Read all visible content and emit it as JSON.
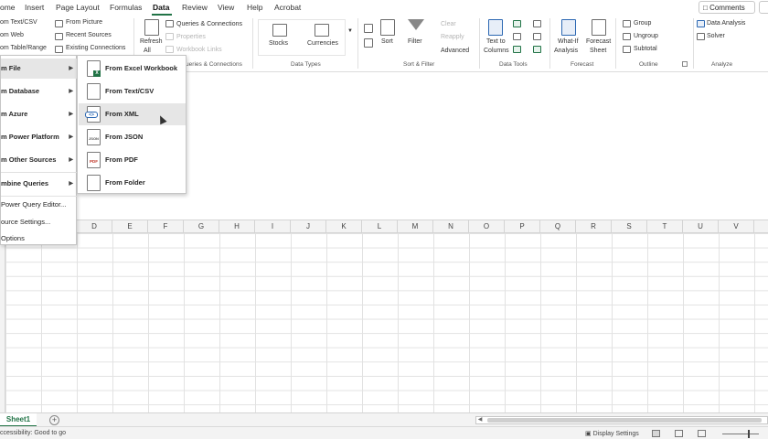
{
  "menubar": {
    "tabs": [
      {
        "label": "ome"
      },
      {
        "label": "Insert"
      },
      {
        "label": "Page Layout"
      },
      {
        "label": "Formulas"
      },
      {
        "label": "Data"
      },
      {
        "label": "Review"
      },
      {
        "label": "View"
      },
      {
        "label": "Help"
      },
      {
        "label": "Acrobat"
      }
    ],
    "active_tab": "Data",
    "comments_label": "Comments"
  },
  "ribbon": {
    "get_data": {
      "from_text_csv": "om Text/CSV",
      "from_web": "om Web",
      "from_table_range": "om Table/Range",
      "from_picture": "From Picture",
      "recent_sources": "Recent Sources",
      "existing_connections": "Existing Connections"
    },
    "queries": {
      "refresh_all_1": "Refresh",
      "refresh_all_2": "All",
      "queries_connections": "Queries & Connections",
      "properties": "Properties",
      "workbook_links": "Workbook Links",
      "group_label": "Queries & Connections"
    },
    "data_types": {
      "stocks": "Stocks",
      "currencies": "Currencies",
      "group_label": "Data Types"
    },
    "sort_filter": {
      "sort": "Sort",
      "filter": "Filter",
      "clear": "Clear",
      "reapply": "Reapply",
      "advanced": "Advanced",
      "group_label": "Sort & Filter"
    },
    "data_tools": {
      "text_to_columns_1": "Text to",
      "text_to_columns_2": "Columns",
      "group_label": "Data Tools"
    },
    "forecast": {
      "whatif_1": "What-If",
      "whatif_2": "Analysis",
      "forecast_sheet_1": "Forecast",
      "forecast_sheet_2": "Sheet",
      "group_label": "Forecast"
    },
    "outline": {
      "group": "Group",
      "ungroup": "Ungroup",
      "subtotal": "Subtotal",
      "group_label": "Outline"
    },
    "analyze": {
      "data_analysis": "Data Analysis",
      "solver": "Solver",
      "group_label": "Analyze"
    }
  },
  "menu_main": {
    "items": [
      {
        "label": "m File"
      },
      {
        "label": "m Database"
      },
      {
        "label": "m Azure"
      },
      {
        "label": "m Power Platform"
      },
      {
        "label": "m Other Sources"
      },
      {
        "label": "mbine Queries"
      }
    ],
    "links": [
      {
        "label": "Power Query Editor..."
      },
      {
        "label": "ource Settings..."
      },
      {
        "label": "Options"
      }
    ]
  },
  "menu_file": {
    "items": [
      {
        "label": "From Excel Workbook",
        "badge": "X"
      },
      {
        "label": "From Text/CSV",
        "badge": ""
      },
      {
        "label": "From XML",
        "badge": "<>"
      },
      {
        "label": "From JSON",
        "badge": "JSON"
      },
      {
        "label": "From PDF",
        "badge": "PDF"
      },
      {
        "label": "From Folder",
        "badge": ""
      }
    ]
  },
  "columns": [
    "D",
    "E",
    "F",
    "G",
    "H",
    "I",
    "J",
    "K",
    "L",
    "M",
    "N",
    "O",
    "P",
    "Q",
    "R",
    "S",
    "T",
    "U",
    "V"
  ],
  "sheetbar": {
    "sheet_name": "Sheet1",
    "add_symbol": "+"
  },
  "statusbar": {
    "accessibility": "ccessibility: Good to go",
    "display_settings": "Display Settings"
  },
  "colors": {
    "excel_green": "#217346",
    "menu_hover": "#e6e6e6"
  }
}
